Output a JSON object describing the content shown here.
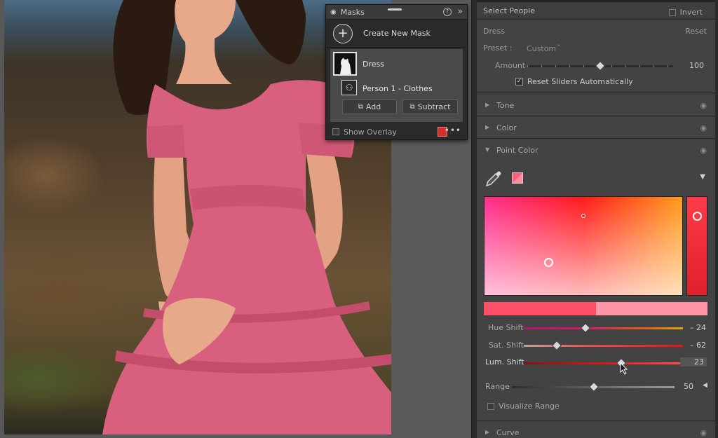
{
  "masks_panel": {
    "title": "Masks",
    "help_icon": "?",
    "collapse_icon": "»",
    "create_label": "Create New Mask",
    "mask_name": "Dress",
    "component_name": "Person 1 - Clothes",
    "add_label": "Add",
    "subtract_label": "Subtract",
    "show_overlay_label": "Show Overlay",
    "overlay_color": "#d6302a",
    "more_icon": "•••"
  },
  "right_panel": {
    "select_people_label": "Select People",
    "invert_label": "Invert",
    "mask_section": {
      "name": "Dress",
      "reset_label": "Reset",
      "preset_label": "Preset :",
      "preset_value": "Custom",
      "preset_chevron": "⌃",
      "amount_label": "Amount",
      "amount_value": "100",
      "amount_fraction": 0.5,
      "reset_sliders_label": "Reset Sliders Automatically",
      "reset_sliders_checked": true
    },
    "sections": {
      "tone": "Tone",
      "color": "Color",
      "point_color": "Point Color",
      "curve": "Curve"
    },
    "point_color": {
      "swatch_color": "#ff5f7a",
      "hue_shift_label": "Hue Shift",
      "hue_shift_value": "– 24",
      "sat_shift_label": "Sat. Shift",
      "sat_shift_value": "– 62",
      "lum_shift_label": "Lum. Shift",
      "lum_shift_value": "23",
      "range_label": "Range",
      "range_value": "50",
      "visualize_range_label": "Visualize Range",
      "original_color": "#ff4f67",
      "shifted_color": "#ff95a5"
    }
  },
  "icons": {
    "eye": "◉",
    "triangle_right": "▶",
    "triangle_down": "▼",
    "range_arrow": "◀",
    "menu_arrow": "▼",
    "plus": "+"
  }
}
